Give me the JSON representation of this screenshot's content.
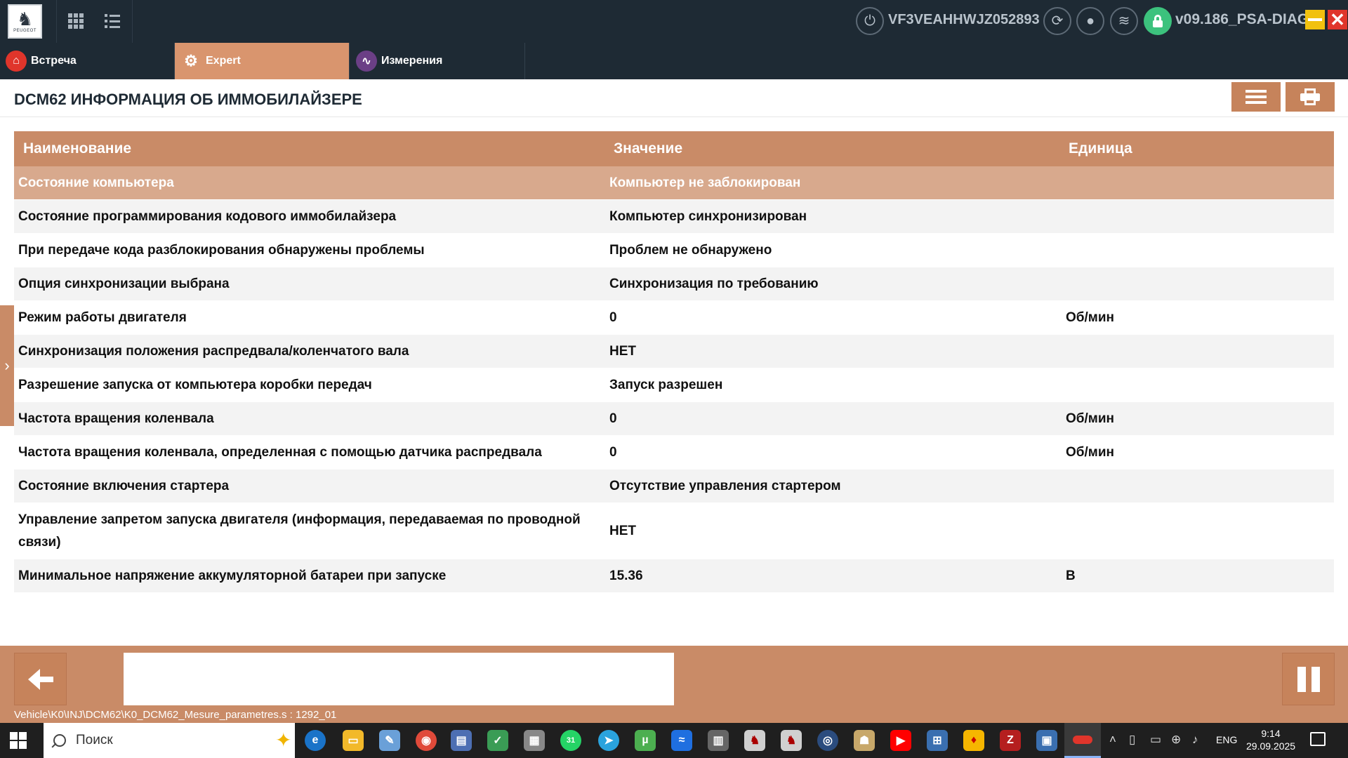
{
  "topbar": {
    "logo_brand": "PEUGEOT",
    "vin": "VF3VEAHHWJZ052893",
    "version": "v09.186_PSA-DIAG",
    "win_close_glyph": "✕"
  },
  "tabs": [
    {
      "label": "Встреча",
      "icon": "home-icon"
    },
    {
      "label": "Expert",
      "icon": "gears-icon"
    },
    {
      "label": "Измерения",
      "icon": "pulse-icon"
    }
  ],
  "page": {
    "title": "DCM62 ИНФОРМАЦИЯ ОБ ИММОБИЛАЙЗЕРЕ"
  },
  "table": {
    "headers": [
      "Наименование",
      "Значение",
      "Единица"
    ],
    "rows": [
      {
        "name": "Состояние компьютера",
        "value": "Компьютер не заблокирован",
        "unit": ""
      },
      {
        "name": "Состояние программирования кодового иммобилайзера",
        "value": "Компьютер синхронизирован",
        "unit": ""
      },
      {
        "name": "При передаче кода разблокирования обнаружены проблемы",
        "value": "Проблем не обнаружено",
        "unit": ""
      },
      {
        "name": "Опция синхронизации выбрана",
        "value": "Синхронизация по требованию",
        "unit": ""
      },
      {
        "name": "Режим работы двигателя",
        "value": "0",
        "unit": "Об/мин"
      },
      {
        "name": "Синхронизация положения распредвала/коленчатого вала",
        "value": "НЕТ",
        "unit": ""
      },
      {
        "name": "Разрешение запуска от компьютера коробки передач",
        "value": "Запуск разрешен",
        "unit": ""
      },
      {
        "name": "Частота вращения коленвала",
        "value": "0",
        "unit": "Об/мин"
      },
      {
        "name": "Частота вращения коленвала, определенная с помощью датчика распредвала",
        "value": "0",
        "unit": "Об/мин"
      },
      {
        "name": "Состояние включения стартера",
        "value": "Отсутствие управления стартером",
        "unit": ""
      },
      {
        "name": "Управление запретом запуска двигателя (информация, передаваемая по проводной связи)",
        "value": "НЕТ",
        "unit": ""
      },
      {
        "name": "Минимальное напряжение аккумуляторной батареи при запуске",
        "value": "15.36",
        "unit": "В"
      }
    ]
  },
  "bottom": {
    "path": "Vehicle\\K0\\INJ\\DCM62\\K0_DCM62_Mesure_parametres.s : 1292_01"
  },
  "taskbar": {
    "search_placeholder": "Поиск",
    "lang": "ENG",
    "time": "9:14",
    "date": "29.09.2025",
    "whatsapp_badge": "31"
  },
  "colors": {
    "accent": "#c98b67",
    "selected_row": "#d8a98d",
    "topbar": "#1e2a34"
  }
}
